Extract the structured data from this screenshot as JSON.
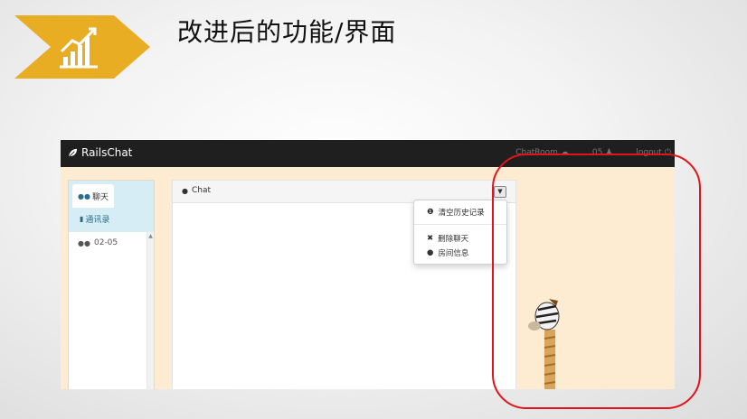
{
  "slide": {
    "title": "改进后的功能/界面",
    "colors": {
      "badge": "#e9ad24",
      "circle": "#e0141a"
    },
    "badge_icon": "growth-chart-icon"
  },
  "app": {
    "brand": "RailsChat",
    "brand_icon": "leaf-icon",
    "nav": {
      "chatroom": "ChatRoom",
      "chatroom_icon": "comments-icon",
      "user": "05",
      "user_icon": "user-icon",
      "logout": "logout",
      "logout_icon": "power-icon"
    },
    "sidebar": {
      "tab_chat": "聊天",
      "tab_contacts": "通讯录",
      "rooms": [
        {
          "label": "02-05",
          "icon": "comments-icon"
        }
      ]
    },
    "panel": {
      "title": "Chat",
      "title_icon": "comment-icon",
      "toggle_icon": "chevron-down-icon"
    },
    "menu": {
      "clear_history": "清空历史记录",
      "delete_chat": "删除聊天",
      "room_info": "房间信息"
    },
    "colors": {
      "navbar": "#1f1f1f",
      "background": "#fdebd2",
      "sidebar_head": "#d7edf5"
    }
  }
}
